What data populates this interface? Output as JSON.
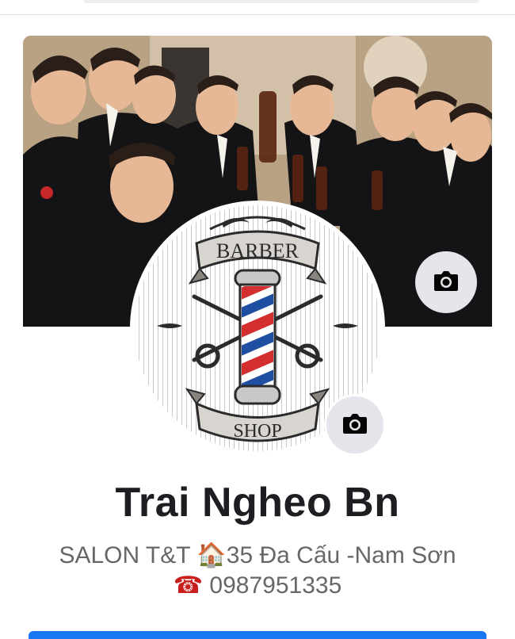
{
  "profile": {
    "name": "Trai Ngheo Bn",
    "bio_line1": "SALON T&T",
    "bio_line1_icon": "house-icon",
    "bio_line1_icon_glyph": "🏠",
    "bio_line1_rest": "35 Đa Cấu -Nam Sơn",
    "bio_line2_icon": "telephone-icon",
    "bio_line2_icon_glyph": "☎",
    "bio_line2_rest": "0987951335"
  },
  "avatar": {
    "logo_top": "BARBER",
    "logo_bottom": "SHOP"
  },
  "colors": {
    "accent": "#1877f2",
    "camera_button_bg": "#e4e6eb",
    "name_text": "#1c1e21",
    "bio_text": "#65676b"
  },
  "icons": {
    "cover_camera": "camera-icon",
    "avatar_camera": "camera-icon"
  }
}
